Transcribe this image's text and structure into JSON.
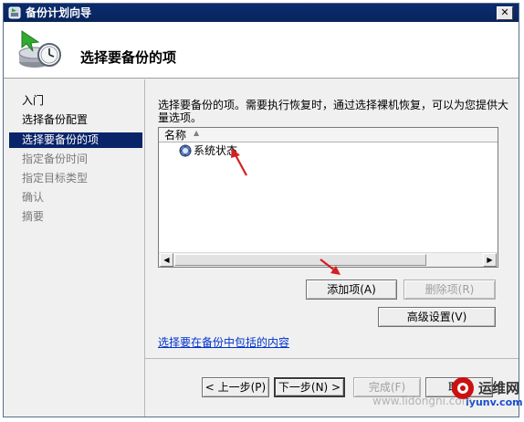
{
  "window": {
    "title": "备份计划向导",
    "close_glyph": "✕"
  },
  "header": {
    "title": "选择要备份的项"
  },
  "sidebar": {
    "items": [
      {
        "label": "入门",
        "state": "done"
      },
      {
        "label": "选择备份配置",
        "state": "done"
      },
      {
        "label": "选择要备份的项",
        "state": "current"
      },
      {
        "label": "指定备份时间",
        "state": "pending"
      },
      {
        "label": "指定目标类型",
        "state": "pending"
      },
      {
        "label": "确认",
        "state": "pending"
      },
      {
        "label": "摘要",
        "state": "pending"
      }
    ]
  },
  "content": {
    "description": "选择要备份的项。需要执行恢复时，通过选择裸机恢复，可以为您提供大量选项。",
    "list": {
      "column_header": "名称",
      "sort_glyph": "▲",
      "rows": [
        {
          "label": "系统状态",
          "icon": "system-state-icon"
        }
      ]
    },
    "scroll_left_glyph": "◀",
    "scroll_right_glyph": "▶",
    "add_button": "添加项(A)",
    "remove_button": "删除项(R)",
    "advanced_button": "高级设置(V)",
    "help_link": "选择要在备份中包括的内容"
  },
  "footer": {
    "back_button": "< 上一步(P)",
    "next_button": "下一步(N) >",
    "finish_button": "完成(F)",
    "cancel_button": "取消"
  },
  "watermark": {
    "site_main": "运维网",
    "site_domain": "iyunv.com",
    "url": "www.lidongni.com"
  },
  "colors": {
    "titlebar": "#0b2c6e",
    "selection": "#0a246a",
    "link": "#0033cc",
    "annotation_arrow": "#d42020",
    "watermark_red": "#cc1010",
    "watermark_blue": "#1a4fd0"
  }
}
